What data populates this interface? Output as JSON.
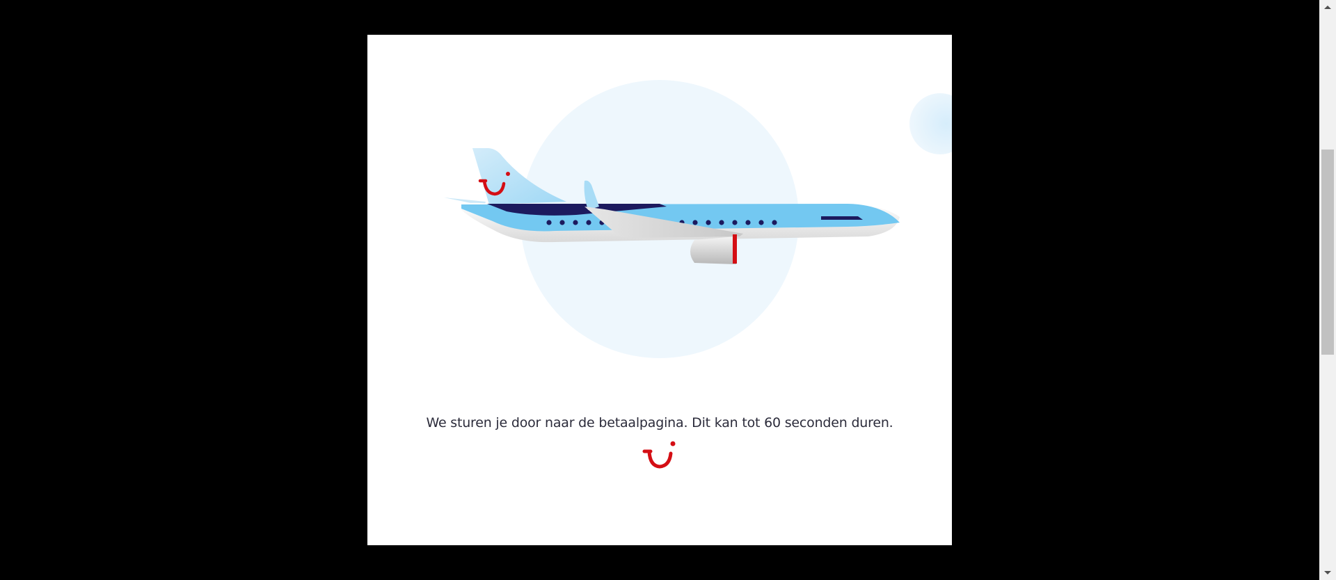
{
  "redirect": {
    "message": "We sturen je door naar de betaalpagina. Dit kan tot 60 seconden duren."
  },
  "icons": {
    "airplane": "airplane-illustration",
    "brand_logo": "tui-smile-logo",
    "scroll_up": "triangle-up-icon",
    "scroll_down": "triangle-down-icon"
  },
  "colors": {
    "brand_red": "#d40e14",
    "plane_light_blue": "#73c8f1",
    "plane_navy": "#1c1a5e",
    "backdrop": "#000000",
    "circle": "#eef7fd"
  }
}
